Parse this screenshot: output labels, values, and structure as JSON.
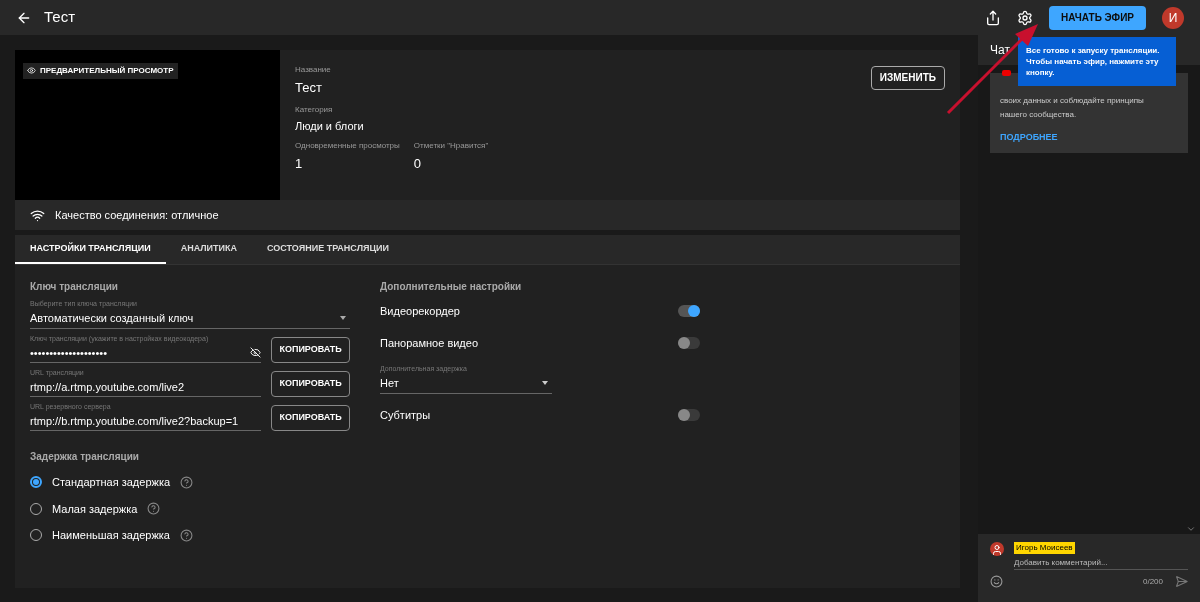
{
  "header": {
    "title": "Тест",
    "start_button": "НАЧАТЬ ЭФИР",
    "avatar": "И"
  },
  "tooltip": {
    "text": "Все готово к запуску трансляции. Чтобы начать эфир, нажмите эту кнопку."
  },
  "preview": {
    "badge": "ПРЕДВАРИТЕЛЬНЫЙ ПРОСМОТР"
  },
  "info": {
    "edit_button": "ИЗМЕНИТЬ",
    "fields": [
      {
        "label": "Название",
        "value": "Тест"
      },
      {
        "label": "Категория",
        "value": "Люди и блоги"
      }
    ],
    "stats": [
      {
        "label": "Одновременные просмотры",
        "value": "1"
      },
      {
        "label": "Отметки \"Нравится\"",
        "value": "0"
      }
    ]
  },
  "connection": "Качество соединения: отличное",
  "tabs": [
    {
      "label": "НАСТРОЙКИ ТРАНСЛЯЦИИ",
      "selected": true
    },
    {
      "label": "АНАЛИТИКА",
      "selected": false
    },
    {
      "label": "СОСТОЯНИЕ ТРАНСЛЯЦИИ",
      "selected": false
    }
  ],
  "stream_key": {
    "heading": "Ключ трансляции",
    "type_label": "Выберите тип ключа трансляции",
    "type_value": "Автоматически созданный ключ",
    "fields": [
      {
        "label": "Ключ трансляции (укажите в настройках видеокодера)",
        "value": "••••••••••••••••••••",
        "hidden": true,
        "button": "КОПИРОВАТЬ"
      },
      {
        "label": "URL трансляции",
        "value": "rtmp://a.rtmp.youtube.com/live2",
        "hidden": false,
        "button": "КОПИРОВАТЬ"
      },
      {
        "label": "URL резервного сервера",
        "value": "rtmp://b.rtmp.youtube.com/live2?backup=1",
        "hidden": false,
        "button": "КОПИРОВАТЬ"
      }
    ]
  },
  "latency": {
    "heading": "Задержка трансляции",
    "options": [
      {
        "label": "Стандартная задержка",
        "selected": true
      },
      {
        "label": "Малая задержка",
        "selected": false
      },
      {
        "label": "Наименьшая задержка",
        "selected": false
      }
    ]
  },
  "extra": {
    "heading": "Дополнительные настройки",
    "items": [
      {
        "kind": "toggle",
        "label": "Видеорекордер",
        "on": true
      },
      {
        "kind": "toggle",
        "label": "Панорамное видео",
        "on": false
      },
      {
        "kind": "select",
        "label": "Дополнительная задержка",
        "value": "Нет"
      },
      {
        "kind": "toggle",
        "label": "Субтитры",
        "on": false
      }
    ]
  },
  "chat": {
    "title": "Чат",
    "notice_lines": [
      "своих данных и соблюдайте принципы",
      "нашего сообщества."
    ],
    "notice_link": "ПОДРОБНЕЕ",
    "user": "Игорь Моисеев",
    "placeholder": "Добавить комментарий...",
    "counter": "0/200"
  }
}
